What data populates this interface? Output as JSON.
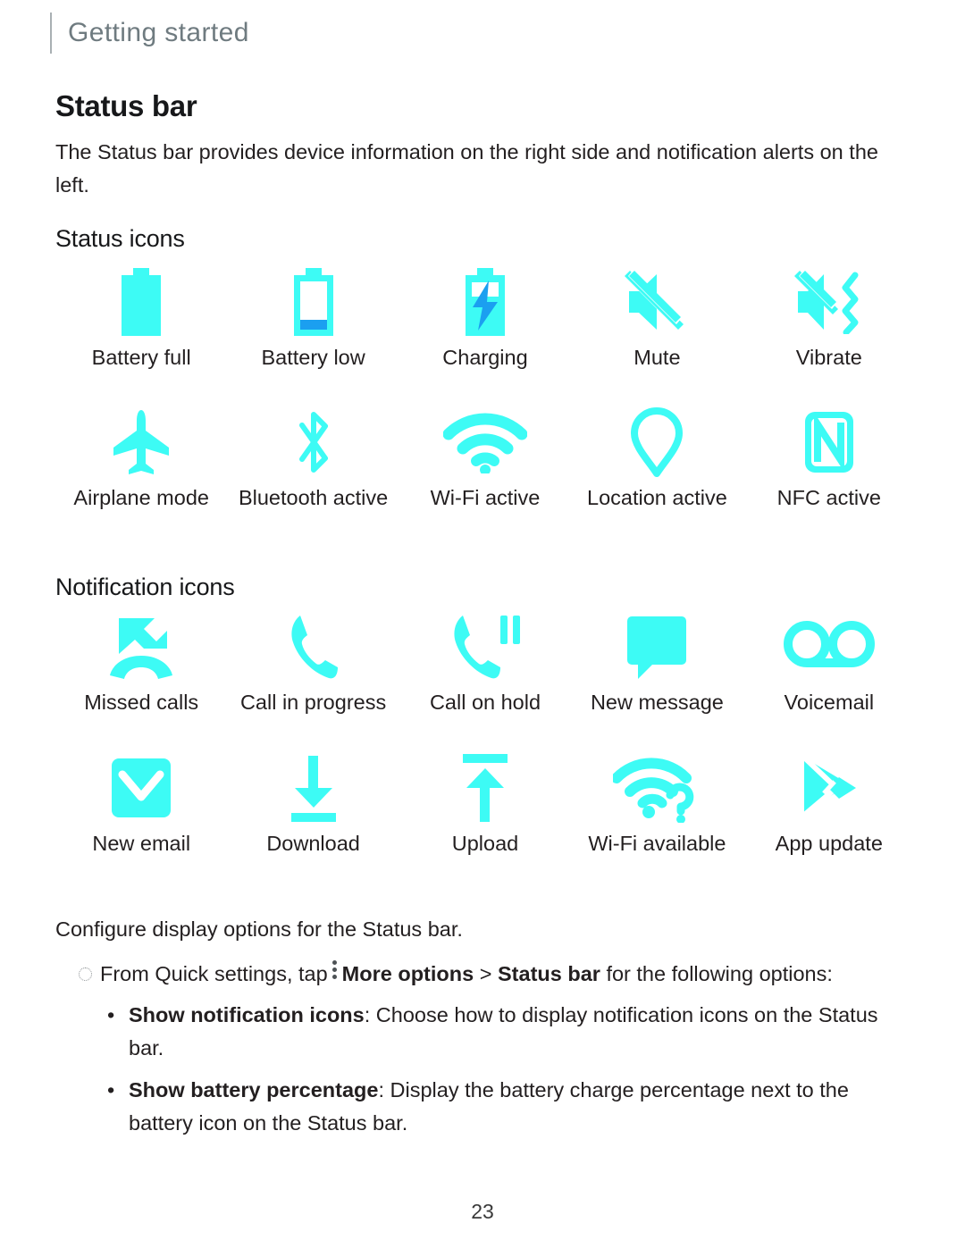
{
  "header": {
    "breadcrumb": "Getting started"
  },
  "page": {
    "title": "Status bar",
    "intro": "The Status bar provides device information on the right side and notification alerts on the left.",
    "number": "23"
  },
  "colors": {
    "icon_cyan": "#3DFBF5",
    "icon_blue": "#1B9FF0",
    "header_text": "#6f7b80",
    "body_text": "#231f20"
  },
  "sections": [
    {
      "heading": "Status icons",
      "rows": [
        {
          "items": [
            {
              "icon": "battery-full-icon",
              "label": "Battery full"
            },
            {
              "icon": "battery-low-icon",
              "label": "Battery low"
            },
            {
              "icon": "battery-charging-icon",
              "label": "Charging"
            },
            {
              "icon": "volume-mute-icon",
              "label": "Mute"
            },
            {
              "icon": "vibrate-icon",
              "label": "Vibrate"
            }
          ]
        },
        {
          "items": [
            {
              "icon": "airplane-icon",
              "label": "Airplane mode"
            },
            {
              "icon": "bluetooth-icon",
              "label": "Bluetooth active"
            },
            {
              "icon": "wifi-icon",
              "label": "Wi-Fi active"
            },
            {
              "icon": "location-pin-icon",
              "label": "Location active"
            },
            {
              "icon": "nfc-icon",
              "label": "NFC active"
            }
          ]
        }
      ]
    },
    {
      "heading": "Notification icons",
      "rows": [
        {
          "items": [
            {
              "icon": "missed-call-icon",
              "label": "Missed calls"
            },
            {
              "icon": "phone-call-icon",
              "label": "Call in progress"
            },
            {
              "icon": "call-on-hold-icon",
              "label": "Call on hold"
            },
            {
              "icon": "message-bubble-icon",
              "label": "New message"
            },
            {
              "icon": "voicemail-icon",
              "label": "Voicemail"
            }
          ]
        },
        {
          "items": [
            {
              "icon": "envelope-icon",
              "label": "New email"
            },
            {
              "icon": "download-arrow-icon",
              "label": "Download"
            },
            {
              "icon": "upload-arrow-icon",
              "label": "Upload"
            },
            {
              "icon": "wifi-question-icon",
              "label": "Wi-Fi available"
            },
            {
              "icon": "play-store-icon",
              "label": "App update"
            }
          ]
        }
      ]
    }
  ],
  "instructions": {
    "configure_line": "Configure display options for the Status bar.",
    "step": {
      "prefix": "From Quick settings, tap",
      "kebab_icon": "more-options-icon",
      "more_options": "More options",
      "separator": ">",
      "target": "Status bar",
      "suffix": "for the following options:"
    },
    "bullets": [
      {
        "marker": "•",
        "term": "Show notification icons",
        "description": ": Choose how to display notification icons on the Status bar."
      },
      {
        "marker": "•",
        "term": "Show battery percentage",
        "description": ": Display the battery charge percentage next to the battery icon on the Status bar."
      }
    ]
  }
}
